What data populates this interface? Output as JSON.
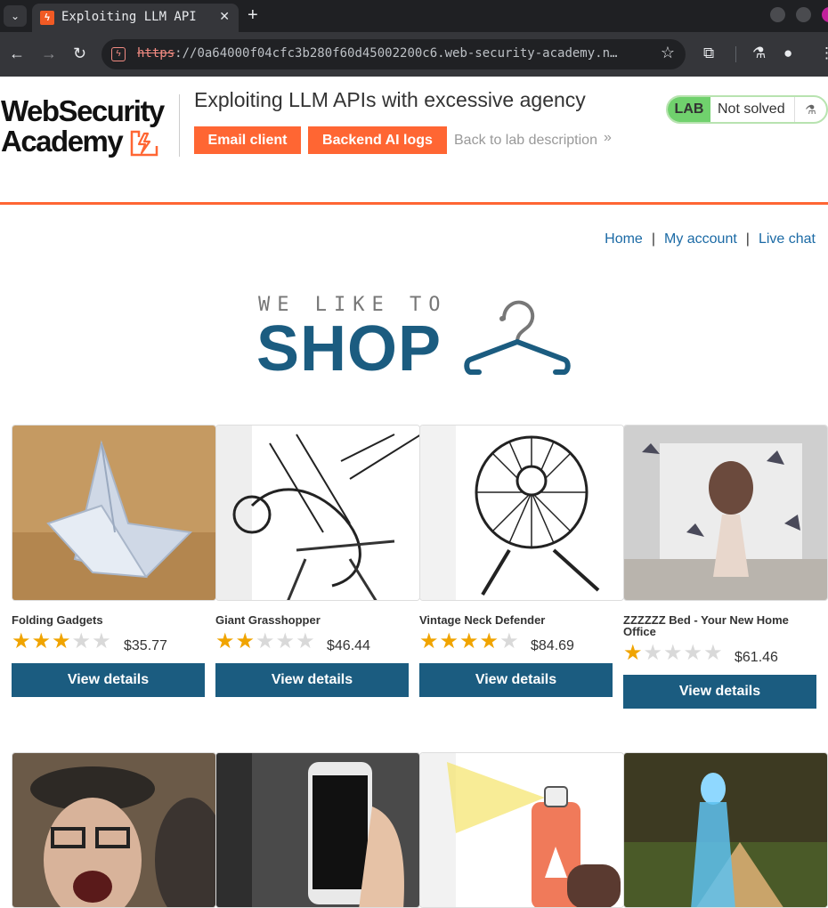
{
  "browser": {
    "tab_title": "Exploiting LLM API",
    "tab_close": "✕",
    "new_tab": "+",
    "url_scheme": "https",
    "url_rest": "://0a64000f04cfc3b280f60d45002200c6.web-security-academy.n…"
  },
  "lab": {
    "logo_line1": "WebSecurity",
    "logo_line2": "Academy",
    "title": "Exploiting LLM APIs with excessive agency",
    "email_client": "Email client",
    "backend_logs": "Backend AI logs",
    "back_link": "Back to lab description",
    "back_chevron": "»",
    "badge_label": "LAB",
    "badge_status": "Not solved",
    "accent_color": "#ff6633",
    "badge_color": "#70d16d"
  },
  "nav": {
    "home": "Home",
    "my_account": "My account",
    "live_chat": "Live chat",
    "separator": "|"
  },
  "banner": {
    "small": "WE LIKE TO",
    "big": "SHOP"
  },
  "products": [
    {
      "name": "Folding Gadgets",
      "rating": 3,
      "price": "$35.77",
      "button": "View details"
    },
    {
      "name": "Giant Grasshopper",
      "rating": 2,
      "price": "$46.44",
      "button": "View details"
    },
    {
      "name": "Vintage Neck Defender",
      "rating": 4,
      "price": "$84.69",
      "button": "View details"
    },
    {
      "name": "ZZZZZZ Bed - Your New Home Office",
      "rating": 1,
      "price": "$61.46",
      "button": "View details"
    }
  ],
  "colors": {
    "link": "#1b6aa5",
    "button": "#1b5c80",
    "star_on": "#f0a400",
    "star_off": "#d9d9d9"
  }
}
